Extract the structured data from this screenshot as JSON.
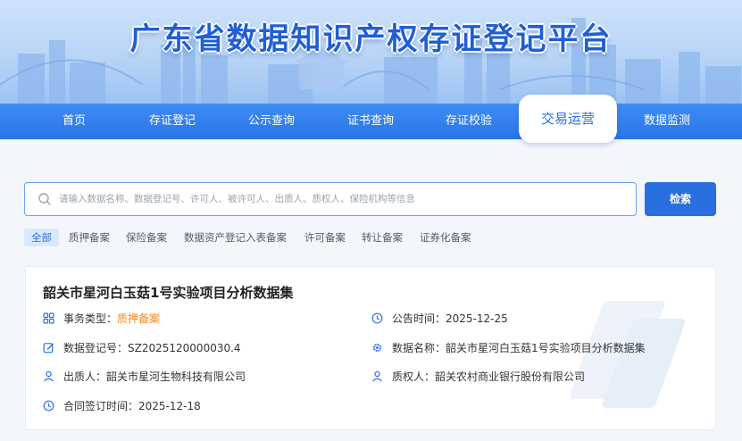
{
  "header": {
    "site_title": "广东省数据知识产权存证登记平台"
  },
  "nav": {
    "items": [
      {
        "label": "首页"
      },
      {
        "label": "存证登记"
      },
      {
        "label": "公示查询"
      },
      {
        "label": "证书查询"
      },
      {
        "label": "存证校验"
      },
      {
        "label": "交易运营"
      },
      {
        "label": "数据监测"
      }
    ],
    "active": "交易运营"
  },
  "search": {
    "placeholder": "请输入数据名称、数据登记号、许可人、被许可人、出质人、质权人、保险机构等信息",
    "value": "",
    "button_label": "检索"
  },
  "filters": [
    {
      "label": "全部",
      "active": true
    },
    {
      "label": "质押备案"
    },
    {
      "label": "保险备案"
    },
    {
      "label": "数据资产登记入表备案"
    },
    {
      "label": "许可备案"
    },
    {
      "label": "转让备案"
    },
    {
      "label": "证券化备案"
    }
  ],
  "record": {
    "title": "韶关市星河白玉菇1号实验项目分析数据集",
    "fields": {
      "business_type_label": "事务类型：",
      "business_type_value": "质押备案",
      "announce_time_label": "公告时间：",
      "announce_time_value": "2025-12-25",
      "reg_no_label": "数据登记号：",
      "reg_no_value": "SZ2025120000030.4",
      "data_name_label": "数据名称：",
      "data_name_value": "韶关市星河白玉菇1号实验项目分析数据集",
      "pledgor_label": "出质人：",
      "pledgor_value": "韶关市星河生物科技有限公司",
      "pledgee_label": "质权人：",
      "pledgee_value": "韶关农村商业银行股份有限公司",
      "sign_time_label": "合同签订时间：",
      "sign_time_value": "2025-12-18"
    }
  },
  "colors": {
    "primary": "#2a6fe0",
    "nav_bg": "#3f8cf3",
    "accent_orange": "#f5871f"
  }
}
